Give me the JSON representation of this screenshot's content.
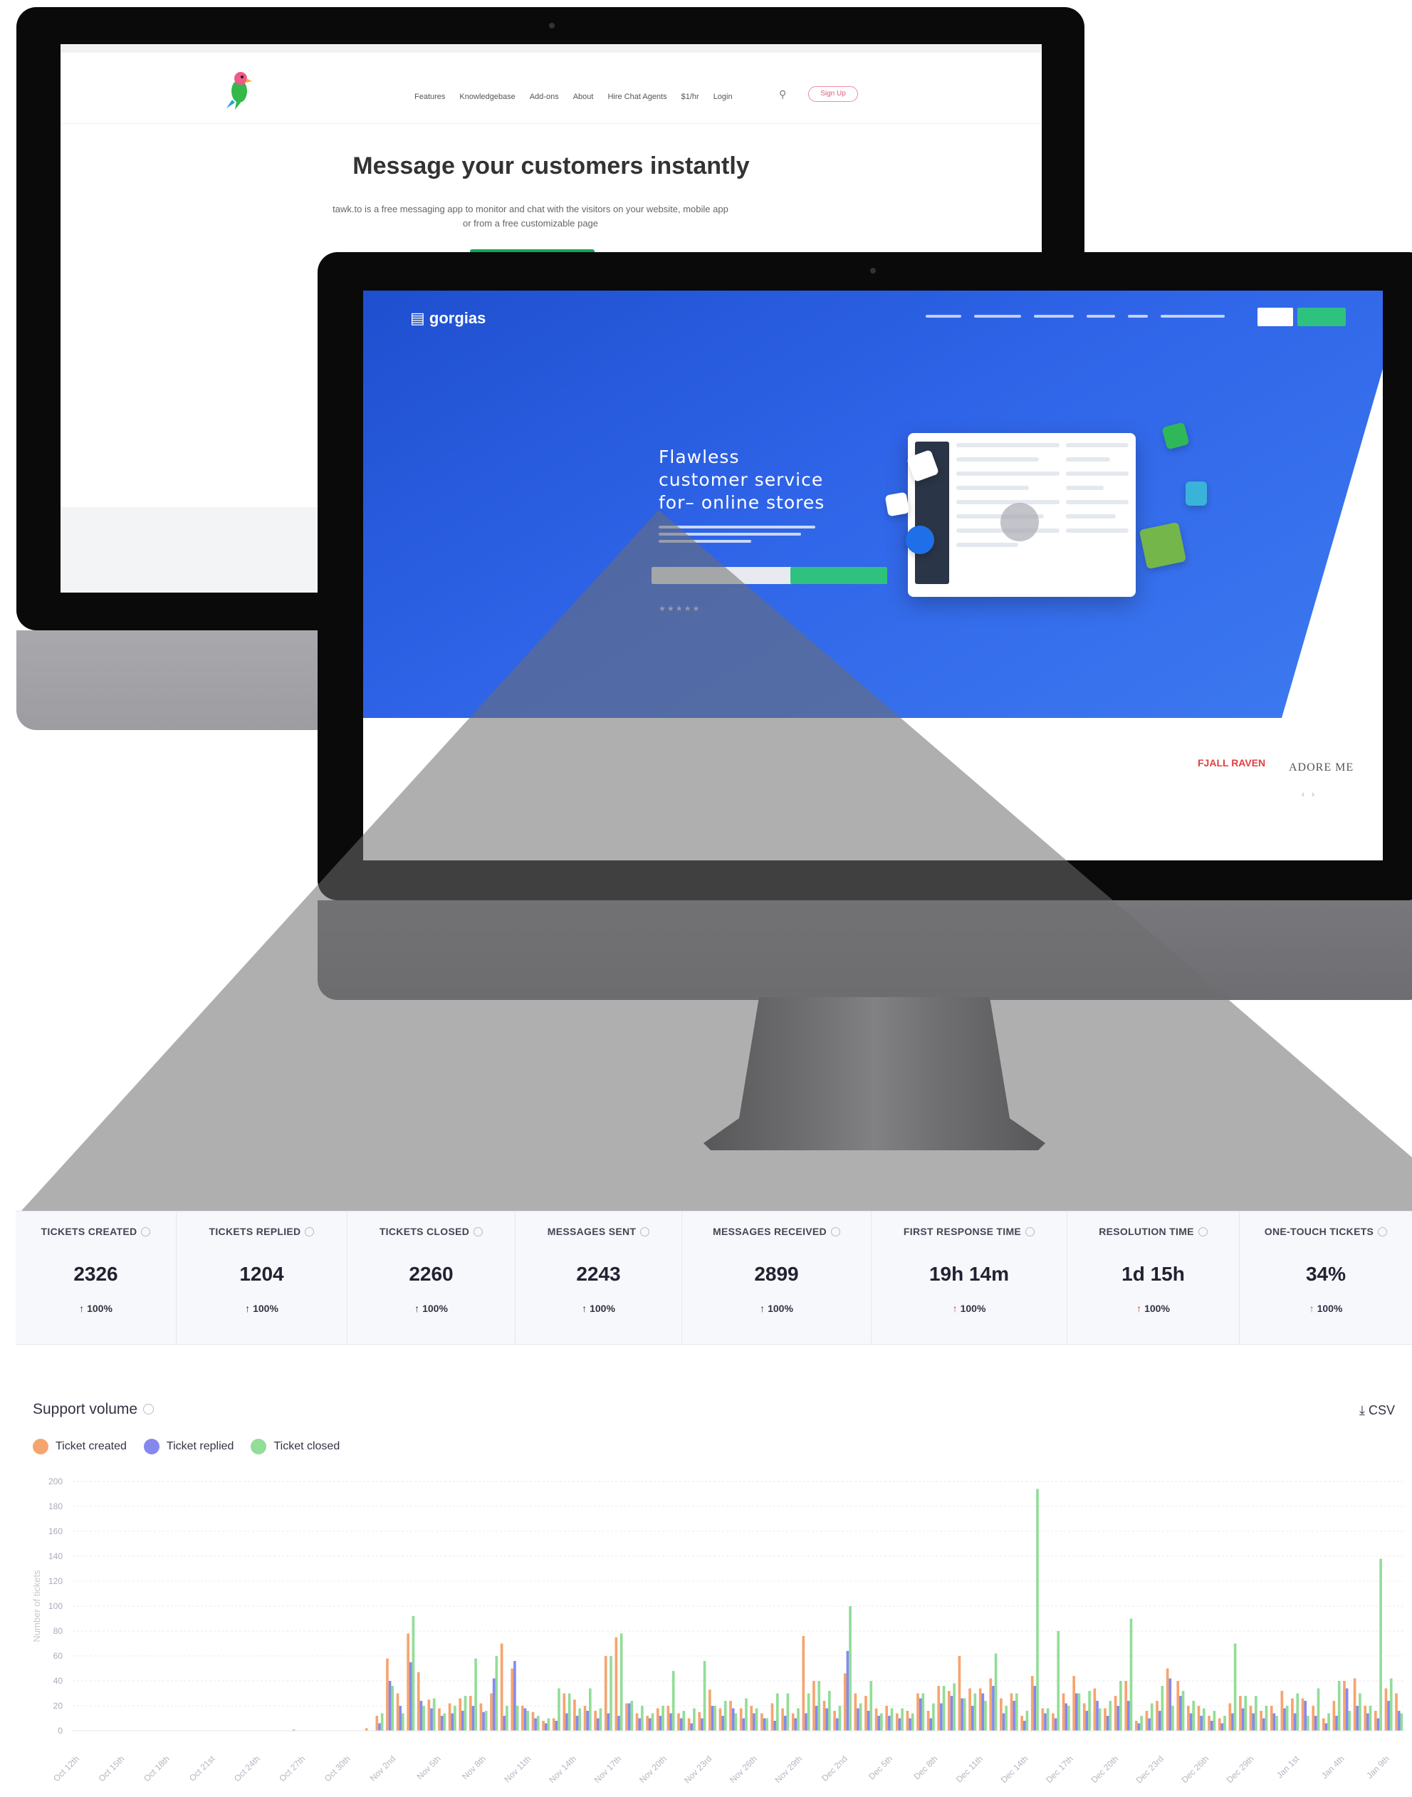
{
  "tawk": {
    "menu": [
      "Features",
      "Knowledgebase",
      "Add-ons",
      "About",
      "Hire Chat Agents",
      "$1/hr",
      "Login"
    ],
    "signup": "Sign Up",
    "title": "Message your customers instantly",
    "subtitle": "tawk.to is a free messaging app to monitor and chat with the visitors on your website, mobile app or from a free customizable page"
  },
  "gorgias": {
    "logo": "gorgias",
    "headline": [
      "Flawless",
      "customer service",
      "for– online stores"
    ],
    "brands": [
      "FJALL RAVEN",
      "ADORE ME"
    ]
  },
  "kpis": [
    {
      "label": "TICKETS CREATED",
      "value": "2326",
      "delta": "100%",
      "color": "#334"
    },
    {
      "label": "TICKETS REPLIED",
      "value": "1204",
      "delta": "100%",
      "color": "#334"
    },
    {
      "label": "TICKETS CLOSED",
      "value": "2260",
      "delta": "100%",
      "color": "#334"
    },
    {
      "label": "MESSAGES SENT",
      "value": "2243",
      "delta": "100%",
      "color": "#334"
    },
    {
      "label": "MESSAGES RECEIVED",
      "value": "2899",
      "delta": "100%",
      "color": "#334"
    },
    {
      "label": "FIRST RESPONSE TIME",
      "value": "19h 14m",
      "delta": "100%",
      "color": "#e0424a"
    },
    {
      "label": "RESOLUTION TIME",
      "value": "1d 15h",
      "delta": "100%",
      "color": "#e0424a"
    },
    {
      "label": "ONE-TOUCH TICKETS",
      "value": "34%",
      "delta": "100%",
      "color": "#2bb673"
    }
  ],
  "chart": {
    "title": "Support volume",
    "csv_label": "CSV",
    "legend": [
      {
        "label": "Ticket created",
        "color": "#f6a46e"
      },
      {
        "label": "Ticket replied",
        "color": "#8589ee"
      },
      {
        "label": "Ticket closed",
        "color": "#92dd98"
      }
    ]
  },
  "chart_data": {
    "type": "bar",
    "ylabel": "Number of tickets",
    "ylim": [
      0,
      200
    ],
    "yticks": [
      0,
      20,
      40,
      60,
      80,
      100,
      120,
      140,
      160,
      180,
      200
    ],
    "grid": true,
    "tick_labels": [
      "Oct 12th",
      "Oct 15th",
      "Oct 18th",
      "Oct 21st",
      "Oct 24th",
      "Oct 27th",
      "Oct 30th",
      "Nov 2nd",
      "Nov 5th",
      "Nov 8th",
      "Nov 11th",
      "Nov 14th",
      "Nov 17th",
      "Nov 20th",
      "Nov 23rd",
      "Nov 26th",
      "Nov 29th",
      "Dec 2nd",
      "Dec 5th",
      "Dec 8th",
      "Dec 11th",
      "Dec 14th",
      "Dec 17th",
      "Dec 20th",
      "Dec 23rd",
      "Dec 26th",
      "Dec 29th",
      "Jan 1st",
      "Jan 4th",
      "Jan 9th"
    ],
    "series": [
      {
        "name": "Ticket created",
        "values": [
          0,
          0,
          0,
          0,
          0,
          0,
          0,
          0,
          0,
          0,
          0,
          0,
          0,
          0,
          0,
          0,
          0,
          0,
          0,
          0,
          0,
          1,
          0,
          0,
          0,
          0,
          0,
          0,
          2,
          12,
          58,
          30,
          78,
          47,
          25,
          18,
          22,
          26,
          28,
          22,
          30,
          70,
          50,
          20,
          15,
          8,
          10,
          30,
          25,
          20,
          16,
          60,
          75,
          22,
          14,
          12,
          18,
          20,
          14,
          10,
          15,
          33,
          18,
          24,
          18,
          20,
          14,
          22,
          18,
          14,
          76,
          40,
          24,
          16,
          46,
          30,
          28,
          18,
          20,
          14,
          16,
          30,
          16,
          36,
          32,
          60,
          34,
          34,
          42,
          26,
          30,
          12,
          44,
          18,
          14,
          30,
          44,
          22,
          34,
          18,
          28,
          40,
          8,
          16,
          24,
          50,
          40,
          20,
          20,
          12,
          10,
          22,
          28,
          20,
          16,
          20,
          32,
          26,
          26,
          20,
          10,
          24,
          40,
          42,
          20,
          16,
          34,
          30
        ]
      },
      {
        "name": "Ticket replied",
        "values": [
          0,
          0,
          0,
          0,
          0,
          0,
          0,
          0,
          0,
          0,
          0,
          0,
          0,
          0,
          0,
          0,
          0,
          0,
          0,
          0,
          0,
          0,
          0,
          0,
          0,
          0,
          0,
          0,
          0,
          6,
          40,
          20,
          55,
          24,
          18,
          12,
          14,
          16,
          20,
          15,
          42,
          12,
          56,
          18,
          10,
          6,
          8,
          14,
          12,
          16,
          10,
          14,
          12,
          22,
          10,
          10,
          12,
          14,
          10,
          6,
          10,
          20,
          12,
          18,
          10,
          14,
          10,
          8,
          12,
          10,
          14,
          20,
          18,
          10,
          64,
          18,
          16,
          12,
          12,
          10,
          10,
          26,
          10,
          22,
          28,
          26,
          20,
          30,
          36,
          14,
          24,
          8,
          36,
          14,
          10,
          22,
          30,
          16,
          24,
          12,
          20,
          24,
          6,
          10,
          16,
          42,
          28,
          14,
          12,
          8,
          6,
          14,
          18,
          14,
          10,
          14,
          18,
          14,
          24,
          12,
          6,
          12,
          34,
          20,
          14,
          10,
          24,
          16
        ]
      },
      {
        "name": "Ticket closed",
        "values": [
          0,
          0,
          0,
          0,
          0,
          0,
          0,
          0,
          0,
          0,
          0,
          0,
          0,
          0,
          0,
          0,
          0,
          0,
          0,
          0,
          0,
          0,
          0,
          0,
          0,
          0,
          0,
          0,
          0,
          14,
          36,
          14,
          92,
          20,
          26,
          14,
          20,
          28,
          58,
          16,
          60,
          20,
          20,
          16,
          12,
          10,
          34,
          30,
          18,
          34,
          18,
          60,
          78,
          24,
          20,
          14,
          20,
          48,
          16,
          18,
          56,
          20,
          24,
          14,
          26,
          18,
          10,
          30,
          30,
          18,
          30,
          40,
          32,
          20,
          100,
          22,
          40,
          14,
          18,
          18,
          14,
          30,
          22,
          36,
          38,
          26,
          30,
          24,
          62,
          20,
          30,
          16,
          194,
          18,
          80,
          20,
          30,
          32,
          18,
          24,
          40,
          90,
          12,
          22,
          36,
          20,
          32,
          24,
          18,
          16,
          12,
          70,
          28,
          28,
          20,
          12,
          20,
          30,
          12,
          34,
          14,
          40,
          16,
          30,
          20,
          138,
          42,
          14
        ]
      }
    ]
  }
}
